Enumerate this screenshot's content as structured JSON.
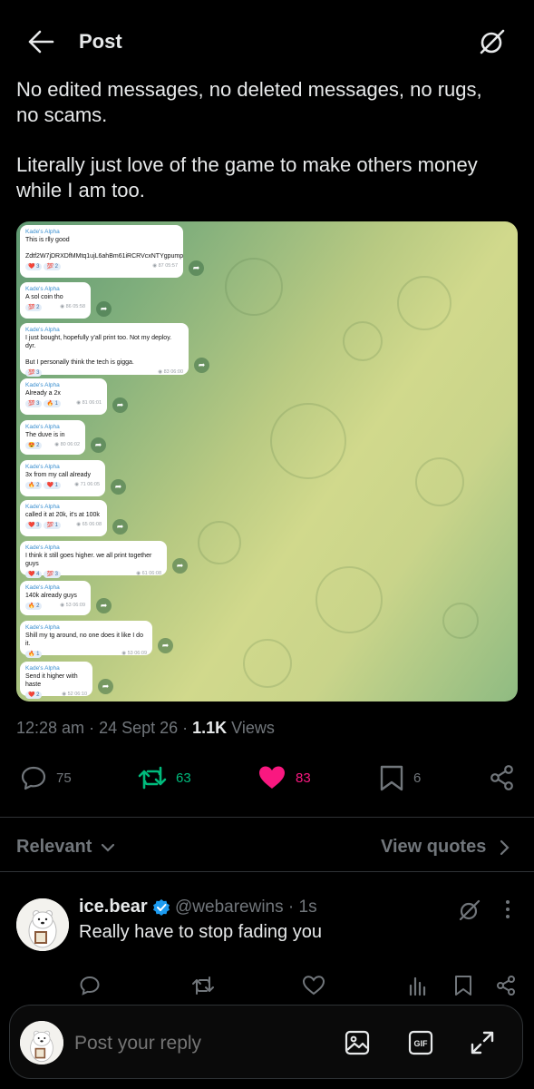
{
  "header": {
    "title": "Post"
  },
  "post": {
    "line1": "No edited messages, no deleted messages, no rugs,",
    "line2": "no scams.",
    "line3": "Literally just love of the game to make others money",
    "line4": "while I am too."
  },
  "telegram": {
    "messages": [
      {
        "name": "Kade's Alpha",
        "lines": [
          "This is rlly good",
          "",
          "Zdtf2W7jDRXDfMMtq1ujL6ahBm61iRCRVcxNTYgpump"
        ],
        "reactions": [
          "❤️ 3",
          "💯 2"
        ],
        "views": "87",
        "time": "05:57"
      },
      {
        "name": "Kade's Alpha",
        "lines": [
          "A sol coin tho"
        ],
        "reactions": [
          "💯 2"
        ],
        "views": "86",
        "time": "05:58"
      },
      {
        "name": "Kade's Alpha",
        "lines": [
          "I just bought, hopefully y'all print too. Not my deploy. dyr.",
          "",
          "But I personally think the tech is gigga."
        ],
        "reactions": [
          "💯 3"
        ],
        "views": "83",
        "time": "06:00"
      },
      {
        "name": "Kade's Alpha",
        "lines": [
          "Already a 2x"
        ],
        "reactions": [
          "💯 3",
          "🔥 1"
        ],
        "views": "81",
        "time": "06:01"
      },
      {
        "name": "Kade's Alpha",
        "lines": [
          "The duve is in"
        ],
        "reactions": [
          "😍 2"
        ],
        "views": "80",
        "time": "06:02"
      },
      {
        "name": "Kade's Alpha",
        "lines": [
          "3x from my call already"
        ],
        "reactions": [
          "🔥 2",
          "❤️ 1"
        ],
        "views": "71",
        "time": "06:05"
      },
      {
        "name": "Kade's Alpha",
        "lines": [
          "called it at 20k, it's at 100k"
        ],
        "reactions": [
          "❤️ 3",
          "💯 1"
        ],
        "views": "65",
        "time": "06:08"
      },
      {
        "name": "Kade's Alpha",
        "lines": [
          "I think it still goes higher. we all print together guys"
        ],
        "reactions": [
          "❤️ 4",
          "💯 3"
        ],
        "views": "61",
        "time": "06:08"
      },
      {
        "name": "Kade's Alpha",
        "lines": [
          "140k already guys"
        ],
        "reactions": [
          "🔥 2"
        ],
        "views": "53",
        "time": "06:09"
      },
      {
        "name": "Kade's Alpha",
        "lines": [
          "Shill my tg around, no one does it like I do it."
        ],
        "reactions": [
          "🔥 1"
        ],
        "views": "53",
        "time": "06:09"
      },
      {
        "name": "Kade's Alpha",
        "lines": [
          "Send it higher with haste"
        ],
        "reactions": [
          "❤️ 2"
        ],
        "views": "52",
        "time": "06:10"
      }
    ]
  },
  "meta": {
    "time": "12:28 am",
    "sep1": " · ",
    "date": "24 Sept 26",
    "sep2": " · ",
    "views_count": "1.1K",
    "views_label": " Views"
  },
  "actions": {
    "replies": "75",
    "reposts": "63",
    "likes": "83",
    "bookmarks": "6"
  },
  "colors": {
    "repost": "#00ba7c",
    "like": "#f91880",
    "verified": "#1d9bf0",
    "muted": "#71767b"
  },
  "tabs": {
    "relevant": "Relevant",
    "view_quotes": "View quotes"
  },
  "reply": {
    "name": "ice.bear",
    "handle": "@webarewins · 1s",
    "text": "Really have to stop fading you"
  },
  "composer": {
    "placeholder": "Post your reply"
  }
}
